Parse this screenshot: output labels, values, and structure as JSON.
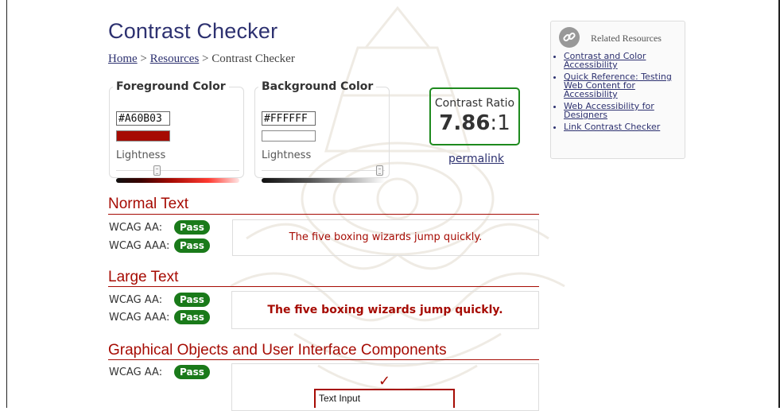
{
  "page": {
    "title": "Contrast Checker",
    "breadcrumb": {
      "home": "Home",
      "sep1": ">",
      "resources": "Resources",
      "sep2": ">",
      "current": "Contrast Checker"
    }
  },
  "foreground": {
    "legend": "Foreground Color",
    "hex": "#A60B03",
    "swatch_color": "#a60b03",
    "lightness_label": "Lightness",
    "lightness": 0.34
  },
  "background": {
    "legend": "Background Color",
    "hex": "#FFFFFF",
    "swatch_color": "#ffffff",
    "lightness_label": "Lightness",
    "lightness": 1.0
  },
  "ratio": {
    "label": "Contrast Ratio",
    "value": "7.86",
    "colon": ":",
    "one": "1",
    "permalink": "permalink"
  },
  "normal_text": {
    "title": "Normal Text",
    "aa_label": "WCAG AA:",
    "aa_result": "Pass",
    "aaa_label": "WCAG AAA:",
    "aaa_result": "Pass",
    "sample": "The five boxing wizards jump quickly."
  },
  "large_text": {
    "title": "Large Text",
    "aa_label": "WCAG AA:",
    "aa_result": "Pass",
    "aaa_label": "WCAG AAA:",
    "aaa_result": "Pass",
    "sample": "The five boxing wizards jump quickly."
  },
  "graphical": {
    "title": "Graphical Objects and User Interface Components",
    "aa_label": "WCAG AA:",
    "aa_result": "Pass",
    "checkmark": "✓",
    "input_value": "Text Input"
  },
  "related": {
    "title": "Related Resources",
    "icon": "link-icon",
    "items": [
      "Contrast and Color Accessibility",
      "Quick Reference: Testing Web Content for Accessibility",
      "Web Accessibility for Designers",
      "Link Contrast Checker"
    ]
  },
  "colors": {
    "accent": "#a60b03",
    "pass": "#1a7a1a",
    "ratio_border": "#1e8a1e",
    "title": "#2d3170"
  }
}
